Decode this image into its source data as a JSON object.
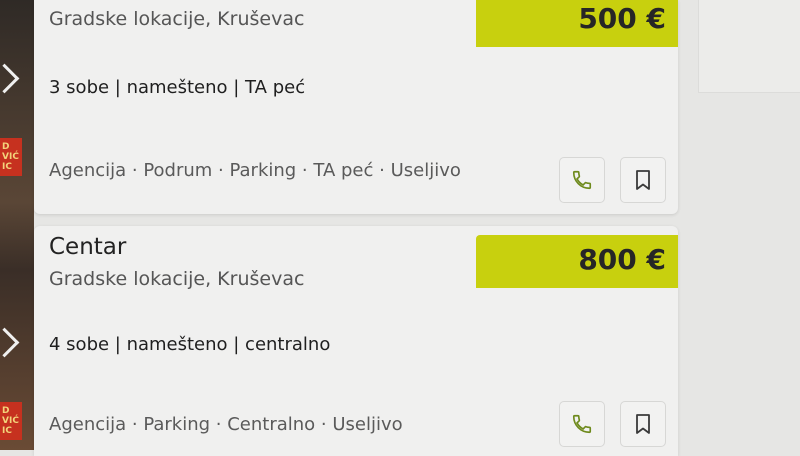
{
  "colors": {
    "price_bg": "#c8d00e",
    "phone_icon": "#6e8a1c",
    "card_bg": "#f0f0ef"
  },
  "listings": [
    {
      "title": "",
      "location": "Gradske lokacije, Kruševac",
      "price": "500 €",
      "summary": "3 sobe | namešteno | TA peć",
      "features": "Agencija · Podrum · Parking · TA peć · Useljivo",
      "icons": [
        "phone-icon",
        "bookmark-icon"
      ]
    },
    {
      "title": "Centar",
      "location": "Gradske lokacije, Kruševac",
      "price": "800 €",
      "summary": "4 sobe | namešteno | centralno",
      "features": "Agencija · Parking · Centralno · Useljivo",
      "icons": [
        "phone-icon",
        "bookmark-icon"
      ]
    }
  ]
}
